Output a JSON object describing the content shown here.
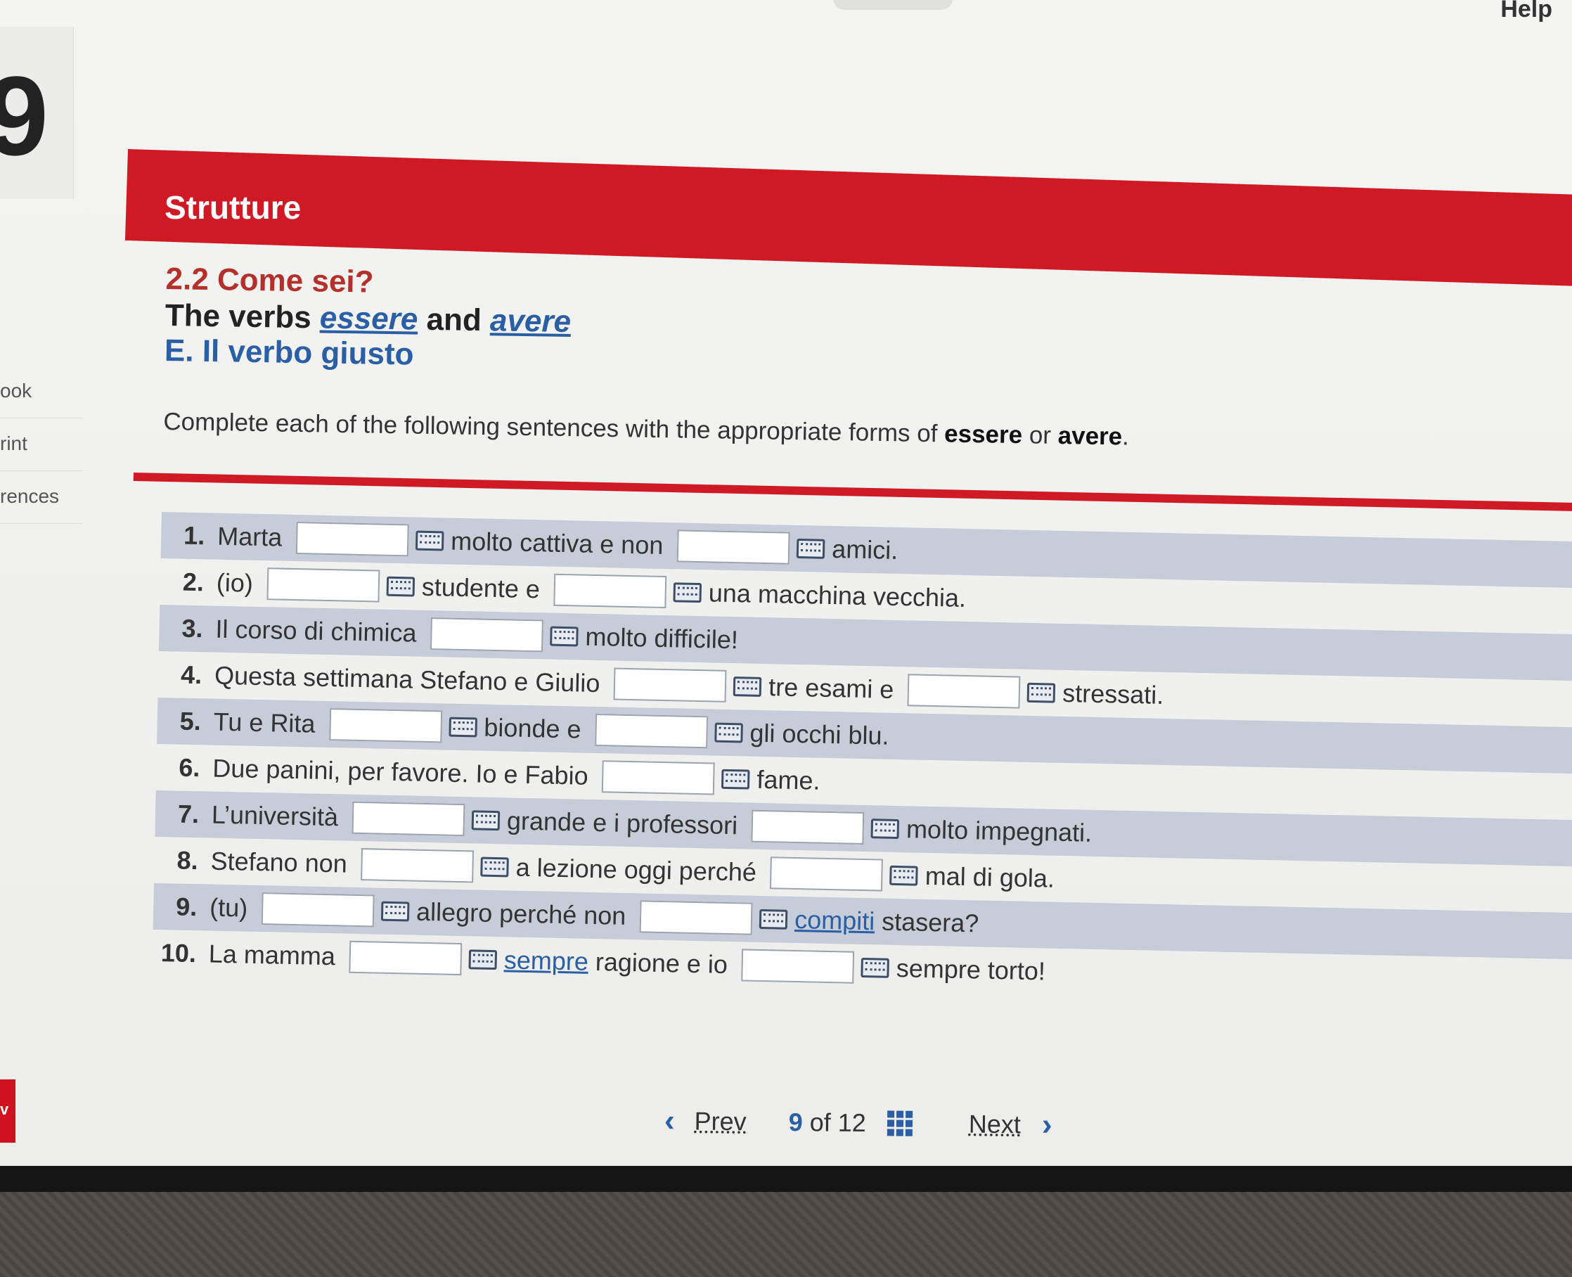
{
  "header": {
    "help_label": "Help"
  },
  "sidebar": {
    "items": [
      {
        "label": "ook"
      },
      {
        "label": "rint"
      },
      {
        "label": "rences"
      }
    ],
    "tab_label": "v"
  },
  "banner": {
    "title": "Strutture"
  },
  "section": {
    "number_title": "2.2 Come sei?",
    "heading_prefix": "The verbs",
    "verb1": "essere",
    "heading_and": "and",
    "verb2": "avere",
    "exercise_title": "E. Il verbo giusto"
  },
  "instructions": {
    "before": "Complete each of the following sentences with the appropriate forms of",
    "word1": "essere",
    "or": "or",
    "word2": "avere",
    "end": "."
  },
  "exercise": {
    "rows": [
      {
        "num": "1.",
        "seg1": "Marta",
        "seg2": "molto cattiva e non",
        "seg3": "amici."
      },
      {
        "num": "2.",
        "seg1": "(io)",
        "seg2": "studente e",
        "seg3": "una macchina vecchia."
      },
      {
        "num": "3.",
        "seg1": "Il corso di chimica",
        "seg2": "molto difficile!"
      },
      {
        "num": "4.",
        "seg1": "Questa settimana Stefano e Giulio",
        "seg2": "tre esami e",
        "seg3": "stressati."
      },
      {
        "num": "5.",
        "seg1": "Tu e Rita",
        "seg2": "bionde e",
        "seg3": "gli occhi blu."
      },
      {
        "num": "6.",
        "seg1": "Due panini, per favore. Io e Fabio",
        "seg2": "fame."
      },
      {
        "num": "7.",
        "seg1": "L’università",
        "seg2": "grande e i professori",
        "seg3": "molto impegnati."
      },
      {
        "num": "8.",
        "seg1": "Stefano non",
        "seg2": "a lezione oggi perché",
        "seg3": "mal di gola."
      },
      {
        "num": "9.",
        "seg1": "(tu)",
        "seg2": "allegro perché non",
        "link": "compiti",
        "seg3": "stasera?"
      },
      {
        "num": "10.",
        "seg1": "La mamma",
        "link": "sempre",
        "seg2": "ragione e io",
        "seg3": "sempre torto!"
      }
    ]
  },
  "pager": {
    "prev_label": "Prev",
    "current": "9",
    "of_label": "of",
    "total": "12",
    "next_label": "Next"
  },
  "colors": {
    "banner_red": "#cf1a26",
    "accent_blue": "#2a5ea5",
    "section_red": "#b5302a",
    "row_shade": "#c6ccd8"
  }
}
